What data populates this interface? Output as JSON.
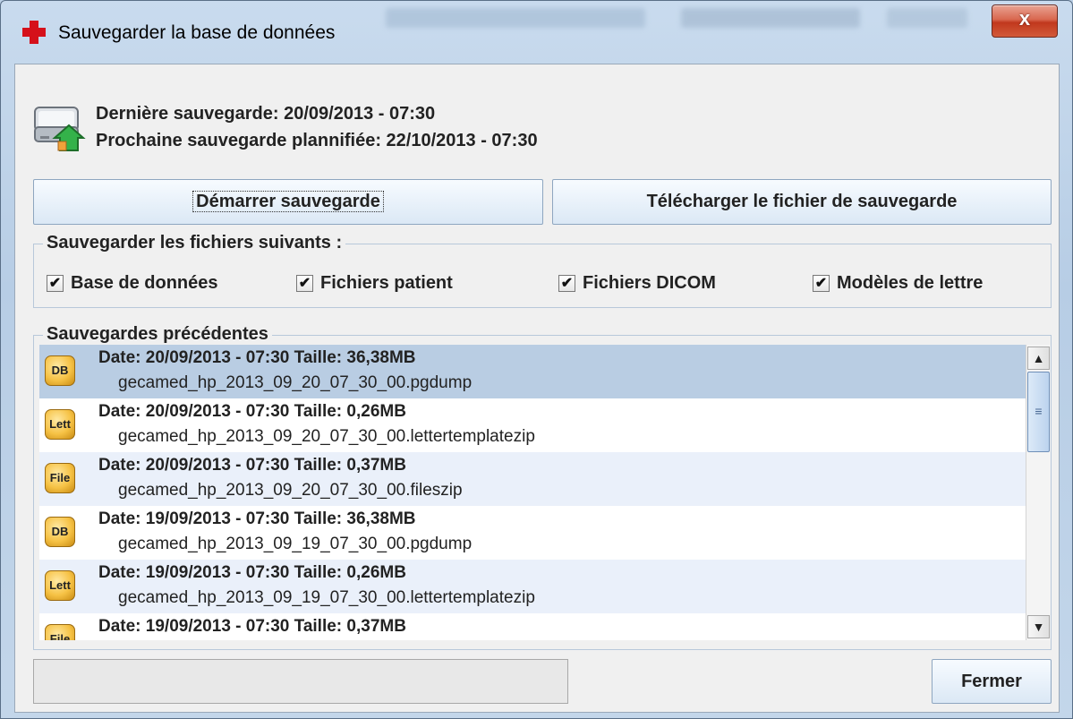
{
  "window": {
    "title": "Sauvegarder la base de données",
    "close_label": "x"
  },
  "info": {
    "last_backup": "Dernière sauvegarde: 20/09/2013 - 07:30",
    "next_backup": "Prochaine sauvegarde plannifiée: 22/10/2013 - 07:30"
  },
  "buttons": {
    "start": "Démarrer sauvegarde",
    "download": "Télécharger le fichier de sauvegarde",
    "close": "Fermer"
  },
  "files_group": {
    "legend": "Sauvegarder les fichiers suivants :",
    "options": [
      {
        "label": "Base de données",
        "checked": true
      },
      {
        "label": "Fichiers patient",
        "checked": true
      },
      {
        "label": "Fichiers DICOM",
        "checked": true
      },
      {
        "label": "Modèles de lettre",
        "checked": true
      }
    ]
  },
  "previous": {
    "legend": "Sauvegardes précédentes",
    "items": [
      {
        "icon": "DB",
        "line1": "Date: 20/09/2013 - 07:30 Taille: 36,38MB",
        "line2": "gecamed_hp_2013_09_20_07_30_00.pgdump"
      },
      {
        "icon": "Lett",
        "line1": "Date: 20/09/2013 - 07:30 Taille: 0,26MB",
        "line2": "gecamed_hp_2013_09_20_07_30_00.lettertemplatezip"
      },
      {
        "icon": "File",
        "line1": "Date: 20/09/2013 - 07:30 Taille: 0,37MB",
        "line2": "gecamed_hp_2013_09_20_07_30_00.fileszip"
      },
      {
        "icon": "DB",
        "line1": "Date: 19/09/2013 - 07:30 Taille: 36,38MB",
        "line2": "gecamed_hp_2013_09_19_07_30_00.pgdump"
      },
      {
        "icon": "Lett",
        "line1": "Date: 19/09/2013 - 07:30 Taille: 0,26MB",
        "line2": "gecamed_hp_2013_09_19_07_30_00.lettertemplatezip"
      },
      {
        "icon": "File",
        "line1": "Date: 19/09/2013 - 07:30 Taille: 0,37MB",
        "line2": ""
      }
    ]
  },
  "status_text": "",
  "colors": {
    "selected_row": "#b9cde3",
    "alt_row": "#eaf0fa",
    "accent_red": "#d5101a"
  }
}
